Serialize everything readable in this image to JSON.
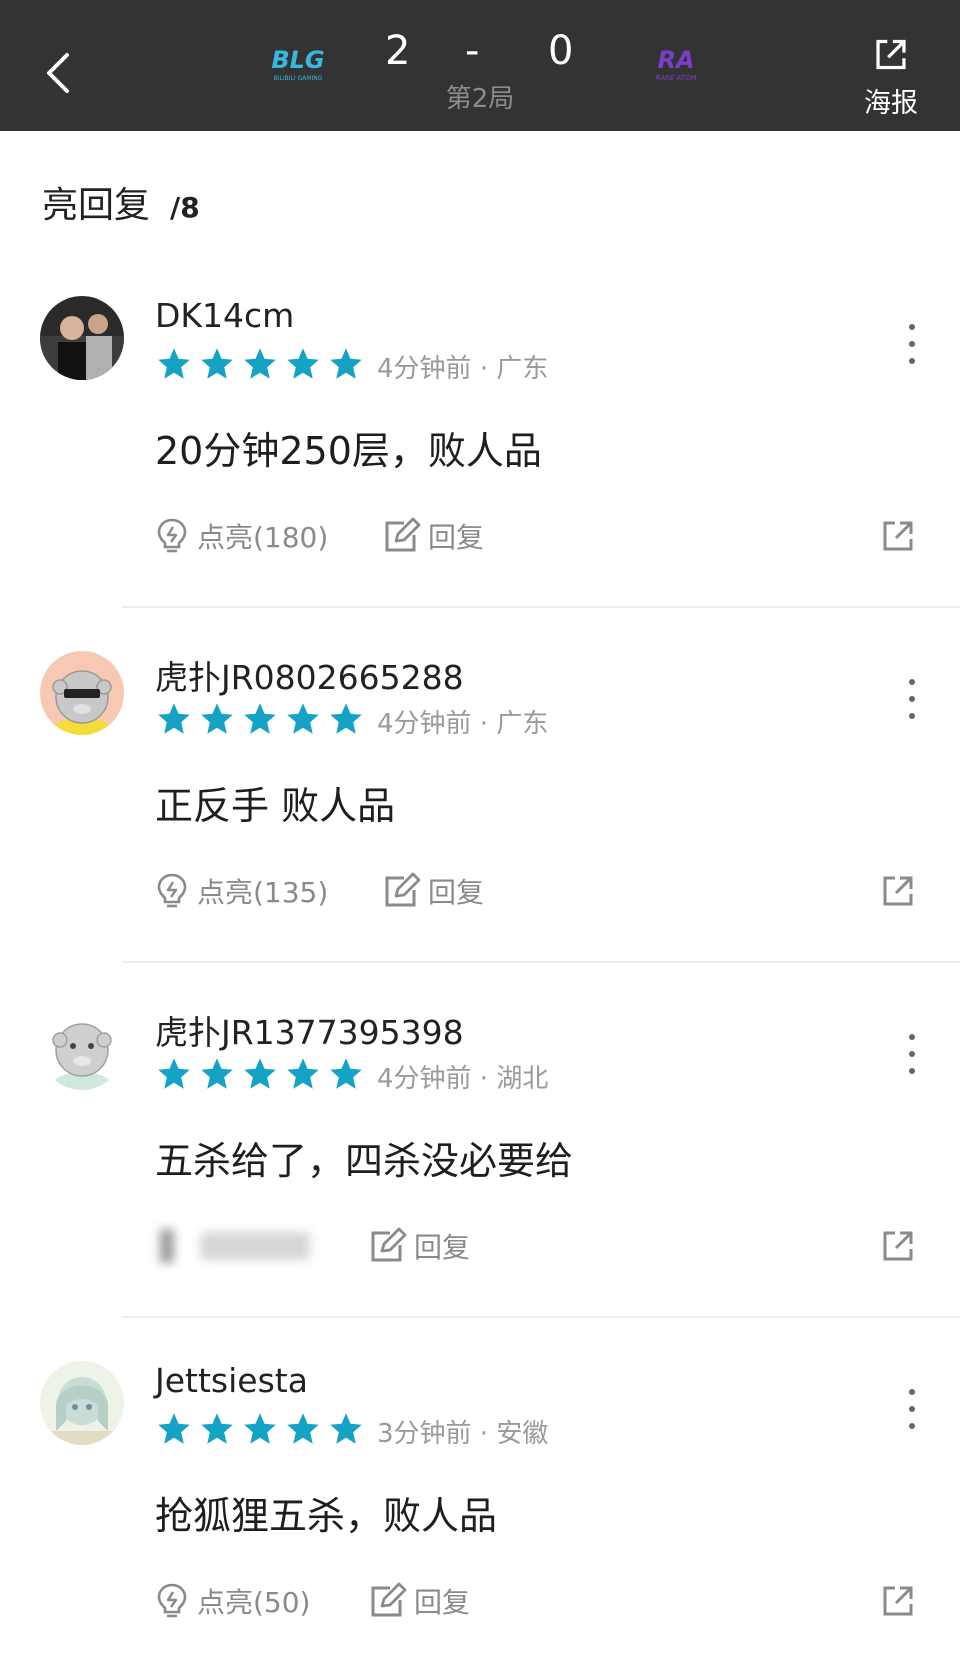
{
  "header": {
    "back_icon": "chevron-left-icon",
    "team_left": {
      "logo_text": "BLG",
      "logo_sub": "BILIBILI GAMING",
      "score": "2"
    },
    "score_separator": "-",
    "team_right": {
      "logo_text": "RA",
      "logo_sub": "RARE ATOM",
      "score": "0"
    },
    "game_label": "第2局",
    "poster_label": "海报",
    "poster_icon": "share-external-icon"
  },
  "section": {
    "title": "亮回复",
    "count": "/8"
  },
  "colors": {
    "header_bg": "#333333",
    "star": "#14a3c4",
    "text_muted": "#9a9a9a",
    "left_logo": "#36b8e0",
    "right_logo": "#7b3ec9"
  },
  "comments": [
    {
      "username": "DK14cm",
      "rating": 5,
      "time": "4分钟前",
      "location": "广东",
      "meta": "4分钟前 · 广东",
      "content": "20分钟250层，败人品",
      "like_label": "点亮(180)",
      "reply_label": "回复"
    },
    {
      "username": "虎扑JR0802665288",
      "rating": 5,
      "time": "4分钟前",
      "location": "广东",
      "meta": "4分钟前 · 广东",
      "content": "正反手 败人品",
      "like_label": "点亮(135)",
      "reply_label": "回复"
    },
    {
      "username": "虎扑JR1377395398",
      "rating": 5,
      "time": "4分钟前",
      "location": "湖北",
      "meta": "4分钟前 · 湖北",
      "content": "五杀给了，四杀没必要给",
      "like_label": "",
      "reply_label": "回复"
    },
    {
      "username": "Jettsiesta",
      "rating": 5,
      "time": "3分钟前",
      "location": "安徽",
      "meta": "3分钟前 · 安徽",
      "content": "抢狐狸五杀，败人品",
      "like_label": "点亮(50)",
      "reply_label": "回复"
    }
  ]
}
